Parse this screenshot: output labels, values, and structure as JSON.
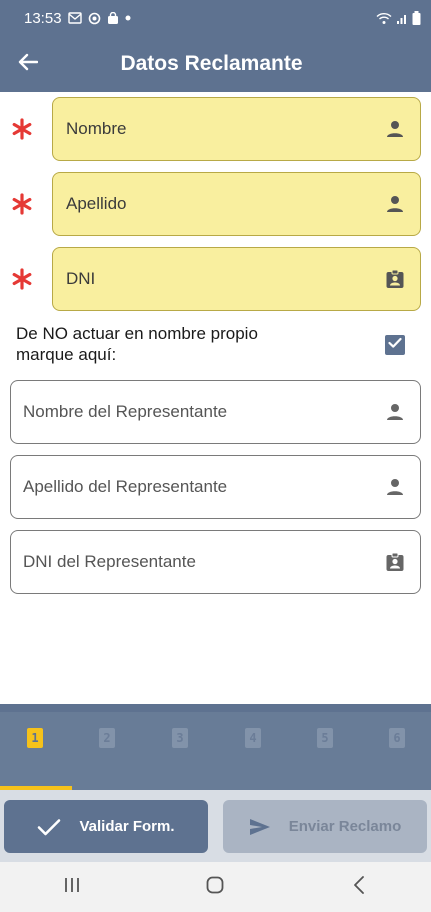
{
  "status_bar": {
    "time": "13:53"
  },
  "app_bar": {
    "title": "Datos Reclamante"
  },
  "form": {
    "nombre": {
      "value": "Nombre",
      "icon": "person-icon"
    },
    "apellido": {
      "value": "Apellido",
      "icon": "person-icon"
    },
    "dni": {
      "value": "DNI",
      "icon": "id-badge-icon"
    },
    "representative_checkbox": {
      "label": "De NO actuar en nombre propio marque aquí:",
      "checked": true
    },
    "rep_nombre": {
      "placeholder": "Nombre del Representante",
      "icon": "person-icon"
    },
    "rep_apellido": {
      "placeholder": "Apellido del Representante",
      "icon": "person-icon"
    },
    "rep_dni": {
      "placeholder": "DNI del Representante",
      "icon": "id-badge-icon"
    }
  },
  "steps": {
    "items": [
      "1",
      "2",
      "3",
      "4",
      "5",
      "6"
    ],
    "current": 1
  },
  "actions": {
    "validate_label": "Validar Form.",
    "send_label": "Enviar Reclamo"
  },
  "colors": {
    "primary": "#5e7290",
    "required_field_bg": "#f9ef9f",
    "required_asterisk": "#e53935",
    "active_step": "#f6c21a"
  }
}
